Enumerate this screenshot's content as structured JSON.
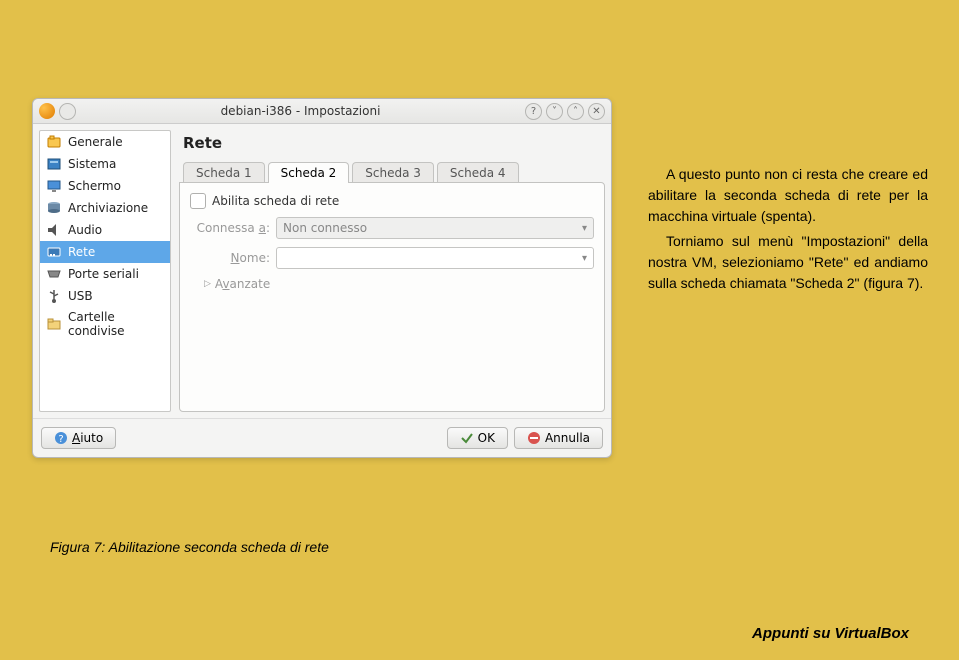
{
  "window": {
    "title": "debian-i386 - Impostazioni"
  },
  "sidebar": {
    "items": [
      {
        "label": "Generale"
      },
      {
        "label": "Sistema"
      },
      {
        "label": "Schermo"
      },
      {
        "label": "Archiviazione"
      },
      {
        "label": "Audio"
      },
      {
        "label": "Rete"
      },
      {
        "label": "Porte seriali"
      },
      {
        "label": "USB"
      },
      {
        "label": "Cartelle condivise"
      }
    ]
  },
  "main": {
    "heading": "Rete",
    "tabs": [
      {
        "label": "Scheda 1"
      },
      {
        "label": "Scheda 2"
      },
      {
        "label": "Scheda 3"
      },
      {
        "label": "Scheda 4"
      }
    ],
    "enable_label": "Abilita scheda di rete",
    "connected_label": "Connessa a:",
    "connected_value": "Non connesso",
    "name_label": "Nome:",
    "advanced_label": "Avanzate"
  },
  "buttons": {
    "help": "Aiuto",
    "ok": "OK",
    "cancel": "Annulla"
  },
  "sidetext": {
    "p1_a": "A questo punto non ci resta che creare ed abilitare la seconda scheda di rete per la macchina virtuale (spenta).",
    "p2_a": "Torniamo sul menù \"Impostazioni\" della nostra VM, selezioniamo \"Rete\" ed andiamo sulla scheda chiamata \"Scheda 2\" (figura 7)."
  },
  "caption": "Figura 7: Abilitazione seconda scheda di rete",
  "footer": "Appunti su VirtualBox"
}
